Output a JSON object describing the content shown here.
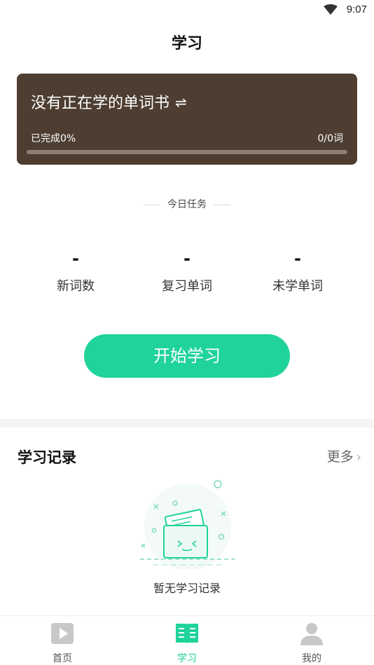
{
  "status_bar": {
    "time": "9:07"
  },
  "header": {
    "title": "学习"
  },
  "book_card": {
    "title": "没有正在学的单词书",
    "switch_symbol": "⇌",
    "progress_label": "已完成0%",
    "progress_count": "0/0词",
    "progress_fraction": 0,
    "background_color": "#4e3e31"
  },
  "today_tasks": {
    "heading": "今日任务",
    "stats": [
      {
        "value": "-",
        "label": "新词数"
      },
      {
        "value": "-",
        "label": "复习单词"
      },
      {
        "value": "-",
        "label": "未学单词"
      }
    ]
  },
  "start_button": {
    "label": "开始学习",
    "color": "#1fd39a"
  },
  "records": {
    "title": "学习记录",
    "more_label": "更多",
    "empty_text": "暂无学习记录"
  },
  "tabbar": {
    "items": [
      {
        "label": "首页",
        "icon": "play-icon"
      },
      {
        "label": "学习",
        "icon": "book-icon"
      },
      {
        "label": "我的",
        "icon": "user-icon"
      }
    ],
    "active_index": 1,
    "accent_color": "#1fd39a"
  }
}
